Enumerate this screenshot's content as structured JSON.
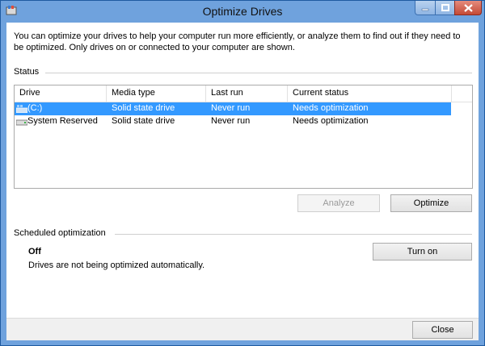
{
  "window": {
    "title": "Optimize Drives",
    "colors": {
      "frame": "#6fa2dd",
      "close": "#c44a36",
      "selection": "#3399ff"
    }
  },
  "description": "You can optimize your drives to help your computer run more efficiently, or analyze them to find out if they need to be optimized. Only drives on or connected to your computer are shown.",
  "status": {
    "label": "Status",
    "columns": [
      "Drive",
      "Media type",
      "Last run",
      "Current status"
    ],
    "rows": [
      {
        "drive": "(C:)",
        "media": "Solid state drive",
        "last_run": "Never run",
        "status": "Needs optimization",
        "icon": "windows-drive-icon",
        "selected": true
      },
      {
        "drive": "System Reserved",
        "media": "Solid state drive",
        "last_run": "Never run",
        "status": "Needs optimization",
        "icon": "drive-icon",
        "selected": false
      }
    ]
  },
  "actions": {
    "analyze": "Analyze",
    "optimize": "Optimize"
  },
  "scheduled": {
    "label": "Scheduled optimization",
    "state": "Off",
    "description": "Drives are not being optimized automatically.",
    "turn_on": "Turn on"
  },
  "footer": {
    "close": "Close"
  }
}
